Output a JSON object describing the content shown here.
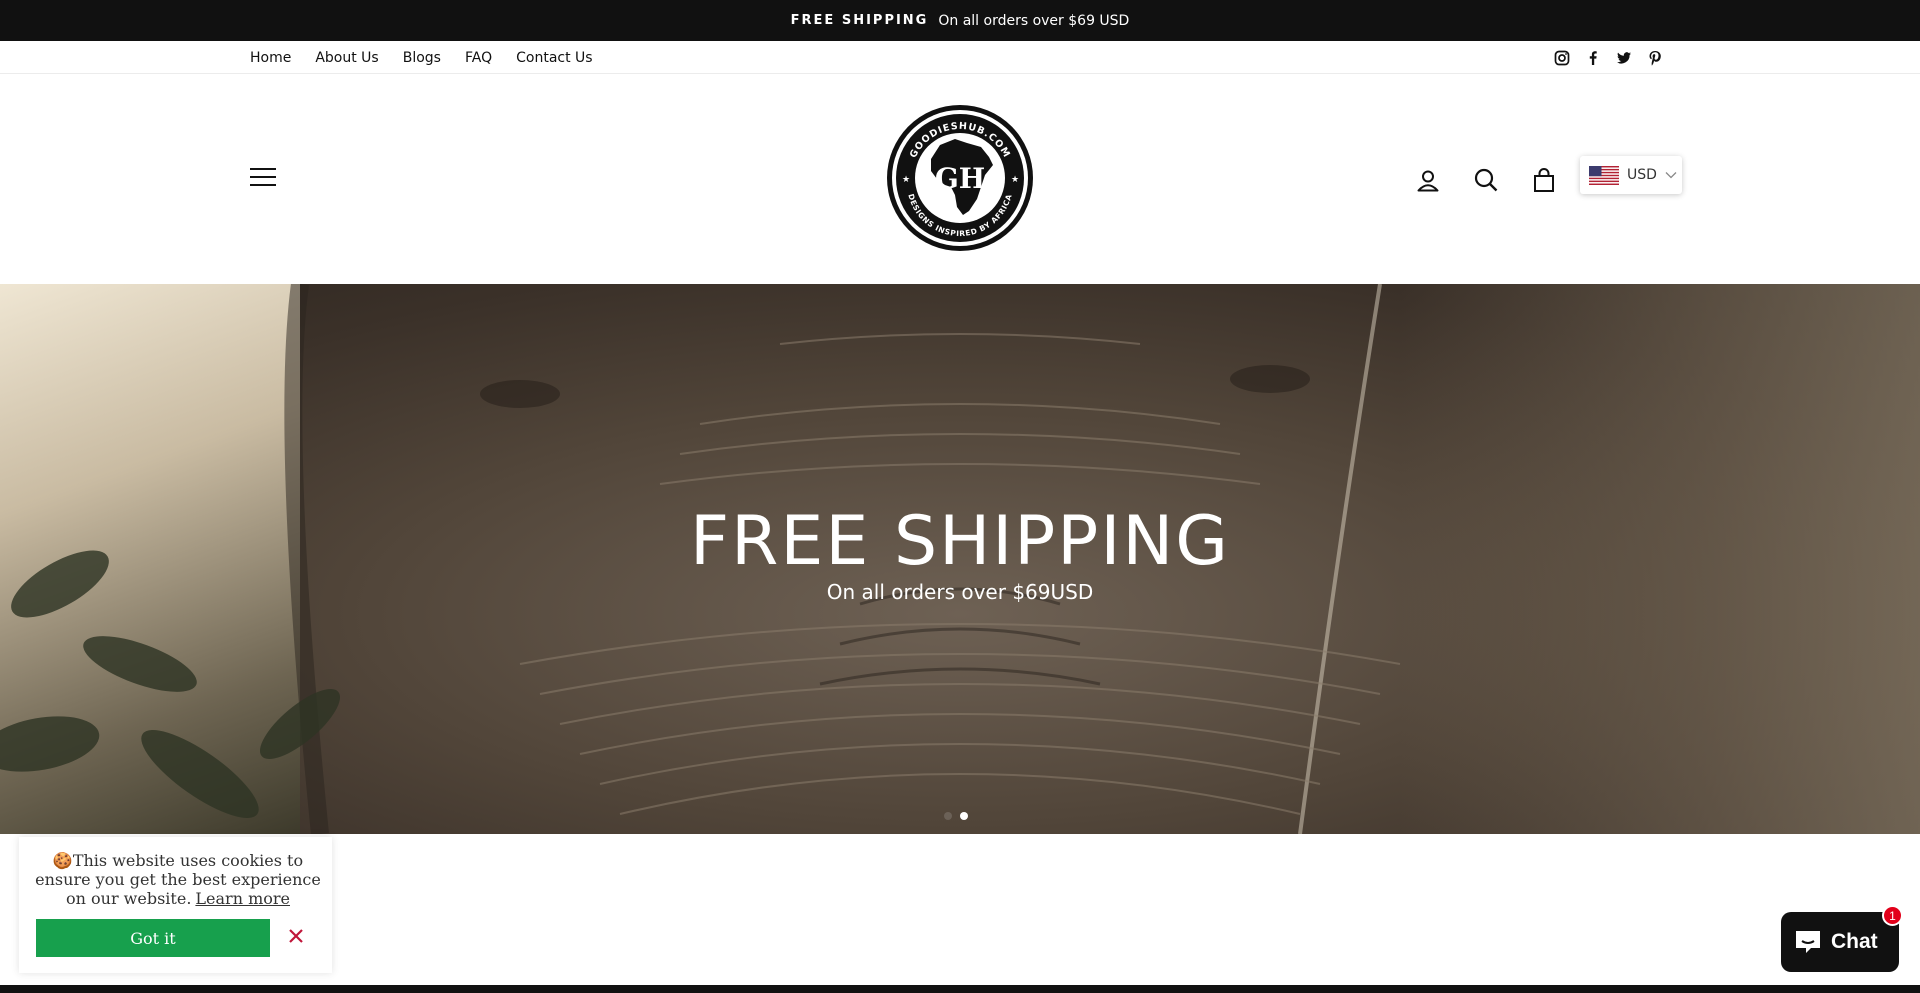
{
  "announcement": {
    "strong": "FREE SHIPPING",
    "text": "On all orders over $69 USD"
  },
  "nav": {
    "links": [
      "Home",
      "About Us",
      "Blogs",
      "FAQ",
      "Contact Us"
    ],
    "social_icons": [
      "instagram-icon",
      "facebook-icon",
      "twitter-icon",
      "pinterest-icon"
    ]
  },
  "header": {
    "logo": {
      "top_text": "GOODIESHUB.COM",
      "center_text": "GH",
      "bottom_text": "DESIGNS INSPIRED BY AFRICA"
    },
    "icons": [
      "account-icon",
      "search-icon",
      "cart-icon"
    ],
    "currency": {
      "code": "USD",
      "flag": "us-flag-icon"
    }
  },
  "hero": {
    "title": "FREE SHIPPING",
    "subtitle": "On all orders over $69USD",
    "slides": 2,
    "active_slide": 2
  },
  "cookie": {
    "message": "This website uses cookies to ensure you get the best experience on our website.",
    "learn_more": "Learn more",
    "button": "Got it"
  },
  "chat": {
    "label": "Chat",
    "badge": "1"
  },
  "colors": {
    "announcement_bg": "#111111",
    "cookie_button": "#17a04d",
    "badge": "#e2001a"
  }
}
